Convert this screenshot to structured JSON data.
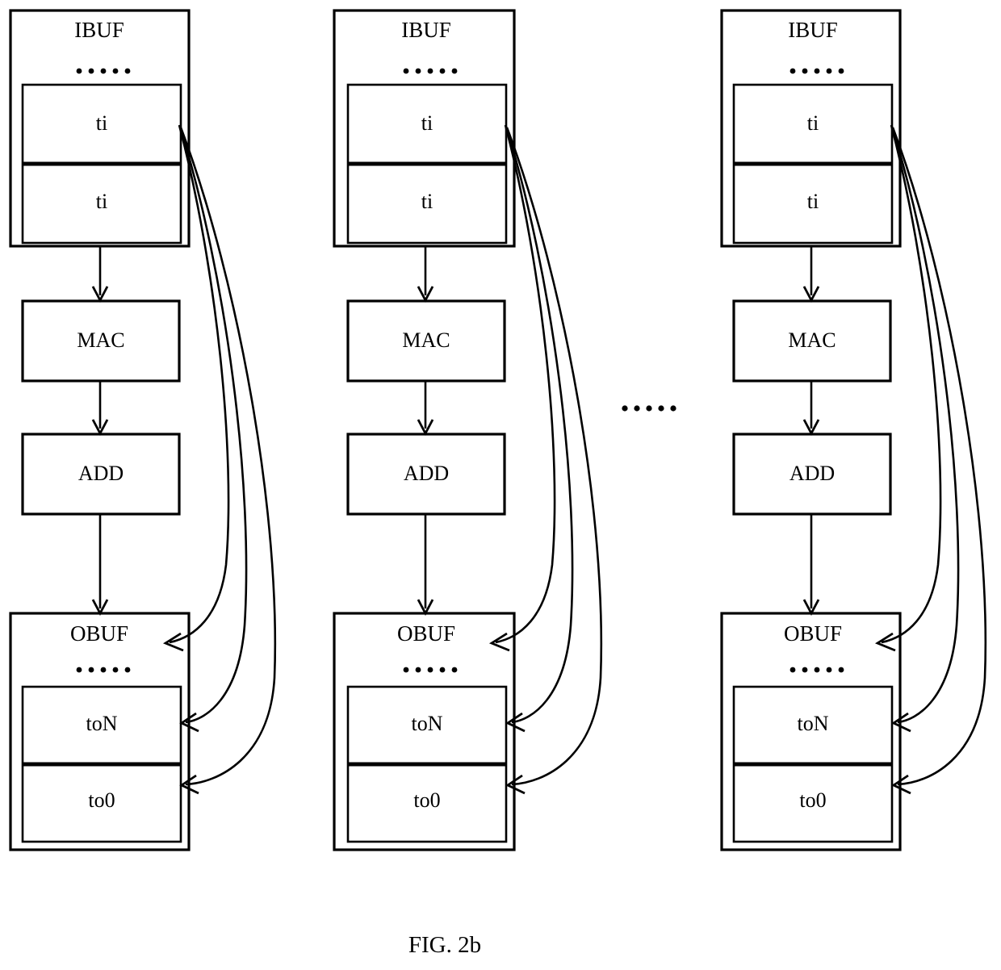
{
  "figure": {
    "caption": "FIG. 2b",
    "between_columns_ellipsis": "......"
  },
  "labels": {
    "ibuf": "IBUF",
    "obuf": "OBUF",
    "mac": "MAC",
    "add": "ADD",
    "ti": "ti",
    "toN": "toN",
    "to0": "to0",
    "ellipsis": "......"
  },
  "columns": [
    {
      "id": "column-1",
      "input_buffer": {
        "title": "IBUF",
        "ellipsis": "......",
        "slots": [
          "ti",
          "ti"
        ]
      },
      "units": [
        "MAC",
        "ADD"
      ],
      "output_buffer": {
        "title": "OBUF",
        "ellipsis": "......",
        "slots": [
          "toN",
          "to0"
        ]
      }
    },
    {
      "id": "column-2",
      "input_buffer": {
        "title": "IBUF",
        "ellipsis": "......",
        "slots": [
          "ti",
          "ti"
        ]
      },
      "units": [
        "MAC",
        "ADD"
      ],
      "output_buffer": {
        "title": "OBUF",
        "ellipsis": "......",
        "slots": [
          "toN",
          "to0"
        ]
      }
    },
    {
      "id": "column-3",
      "input_buffer": {
        "title": "IBUF",
        "ellipsis": "......",
        "slots": [
          "ti",
          "ti"
        ]
      },
      "units": [
        "MAC",
        "ADD"
      ],
      "output_buffer": {
        "title": "OBUF",
        "ellipsis": "......",
        "slots": [
          "toN",
          "to0"
        ]
      }
    }
  ],
  "colors": {
    "stroke": "#000000",
    "background": "#ffffff"
  }
}
